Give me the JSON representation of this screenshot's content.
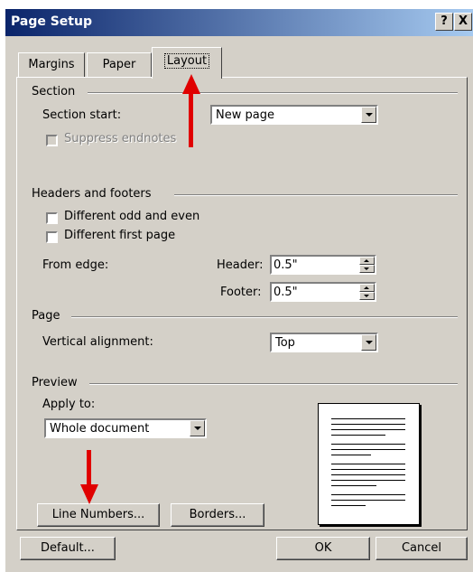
{
  "window": {
    "title": "Page Setup",
    "help_label": "?",
    "close_label": "X"
  },
  "tabs": [
    {
      "label": "Margins"
    },
    {
      "label": "Paper"
    },
    {
      "label": "Layout"
    }
  ],
  "section": {
    "heading": "Section",
    "start_label": "Section start:",
    "start_value": "New page",
    "suppress_label": "Suppress endnotes"
  },
  "headers": {
    "heading": "Headers and footers",
    "odd_even_label": "Different odd and even",
    "first_page_label": "Different first page",
    "from_edge_label": "From edge:",
    "header_label": "Header:",
    "header_value": "0.5\"",
    "footer_label": "Footer:",
    "footer_value": "0.5\""
  },
  "page": {
    "heading": "Page",
    "valign_label": "Vertical alignment:",
    "valign_value": "Top"
  },
  "preview": {
    "heading": "Preview",
    "apply_label": "Apply to:",
    "apply_value": "Whole document"
  },
  "buttons": {
    "line_numbers": "Line Numbers...",
    "borders": "Borders...",
    "default": "Default...",
    "ok": "OK",
    "cancel": "Cancel"
  },
  "accent": {
    "title_bar": "#0a246a",
    "arrow": "#e00000"
  }
}
